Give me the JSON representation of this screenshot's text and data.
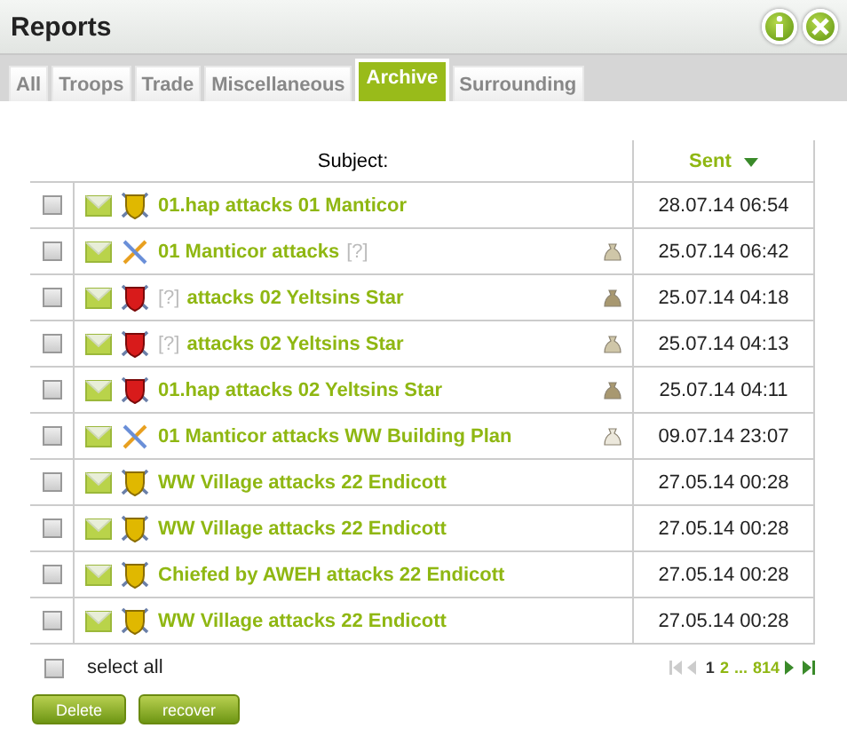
{
  "window": {
    "title": "Reports"
  },
  "tabs": [
    {
      "label": "All",
      "selected": false
    },
    {
      "label": "Troops",
      "selected": false
    },
    {
      "label": "Trade",
      "selected": false
    },
    {
      "label": "Miscellaneous",
      "selected": false
    },
    {
      "label": "Archive",
      "selected": true
    },
    {
      "label": "Surrounding",
      "selected": false
    }
  ],
  "table": {
    "columns": [
      "Subject:",
      "Sent"
    ],
    "rows": [
      {
        "checked": false,
        "kind": "win",
        "subject": [
          {
            "text": "01.hap attacks 01 Manticor",
            "unknown": false
          }
        ],
        "sent": "28.07.14 06:54"
      },
      {
        "checked": false,
        "kind": "neutral",
        "loot": {
          "kind": "partial"
        },
        "subject": [
          {
            "text": "01 Manticor attacks",
            "unknown": false
          },
          {
            "text": "[?]",
            "unknown": true
          }
        ],
        "sent": "25.07.14 06:42"
      },
      {
        "checked": false,
        "kind": "loss",
        "loot": {
          "kind": "full"
        },
        "subject": [
          {
            "text": "[?]",
            "unknown": true
          },
          {
            "text": "attacks 02 Yeltsins Star",
            "unknown": false
          }
        ],
        "sent": "25.07.14 04:18"
      },
      {
        "checked": false,
        "kind": "loss",
        "loot": {
          "kind": "partial"
        },
        "subject": [
          {
            "text": "[?]",
            "unknown": true
          },
          {
            "text": "attacks 02 Yeltsins Star",
            "unknown": false
          }
        ],
        "sent": "25.07.14 04:13"
      },
      {
        "checked": false,
        "kind": "loss",
        "loot": {
          "kind": "full"
        },
        "subject": [
          {
            "text": "01.hap attacks 02 Yeltsins Star",
            "unknown": false
          }
        ],
        "sent": "25.07.14 04:11"
      },
      {
        "checked": false,
        "kind": "neutral",
        "loot": {
          "kind": "empty"
        },
        "subject": [
          {
            "text": "01 Manticor attacks WW Building Plan",
            "unknown": false
          }
        ],
        "sent": "09.07.14 23:07"
      },
      {
        "checked": false,
        "kind": "win",
        "subject": [
          {
            "text": "WW Village attacks 22 Endicott",
            "unknown": false
          }
        ],
        "sent": "27.05.14 00:28"
      },
      {
        "checked": false,
        "kind": "win",
        "subject": [
          {
            "text": "WW Village attacks 22 Endicott",
            "unknown": false
          }
        ],
        "sent": "27.05.14 00:28"
      },
      {
        "checked": false,
        "kind": "win",
        "subject": [
          {
            "text": "Chiefed by AWEH attacks 22 Endicott",
            "unknown": false
          }
        ],
        "sent": "27.05.14 00:28"
      },
      {
        "checked": false,
        "kind": "win",
        "subject": [
          {
            "text": "WW Village attacks 22 Endicott",
            "unknown": false
          }
        ],
        "sent": "27.05.14 00:28"
      }
    ]
  },
  "select_all": {
    "label": "select all",
    "checked": false
  },
  "pagination": {
    "first_disabled": true,
    "last_disabled": false,
    "pages": [
      {
        "label": "1",
        "selected": true
      },
      {
        "label": "2",
        "selected": false
      },
      {
        "label": "...",
        "selected": false
      },
      {
        "label": "814",
        "selected": false
      }
    ]
  },
  "buttons": [
    "Delete",
    "recover"
  ]
}
